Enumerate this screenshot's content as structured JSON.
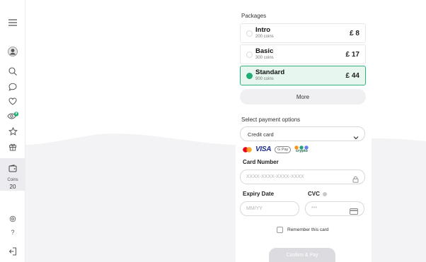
{
  "sidebar": {
    "coins_label": "Coins",
    "coins_value": "20",
    "badge_count": "0",
    "icons": [
      "menu-icon",
      "avatar",
      "search-icon",
      "chat-icon",
      "heart-icon",
      "eye-icon",
      "star-icon",
      "gift-icon",
      "wallet-icon",
      "settings-icon",
      "help-icon",
      "logout-icon"
    ]
  },
  "packages": {
    "title": "Packages",
    "items": [
      {
        "name": "Intro",
        "coins": "200 coins",
        "price": "£ 8",
        "selected": false
      },
      {
        "name": "Basic",
        "coins": "300 coins",
        "price": "£ 17",
        "selected": false
      },
      {
        "name": "Standard",
        "coins": "900 coins",
        "price": "£ 44",
        "selected": true
      }
    ],
    "more_label": "More"
  },
  "payment": {
    "title": "Select payment options",
    "method_selected": "Credit card",
    "logos": {
      "visa": "VISA",
      "gpay": "G Pay",
      "crypto": "crypto"
    },
    "card_number_label": "Card Number",
    "card_number_placeholder": "XXXX-XXXX-XXXX-XXXX",
    "expiry_label": "Expiry Date",
    "expiry_placeholder": "MM/YY",
    "cvc_label": "CVC",
    "cvc_placeholder": "***",
    "remember_label": "Remember this card",
    "confirm_label": "Confirm & Pay"
  },
  "colors": {
    "accent": "#1fae73",
    "selected_bg": "#e7f6ef",
    "visa_blue": "#1a2b8f",
    "mastercard_red": "#eb001b",
    "mastercard_orange": "#f79e1b"
  }
}
